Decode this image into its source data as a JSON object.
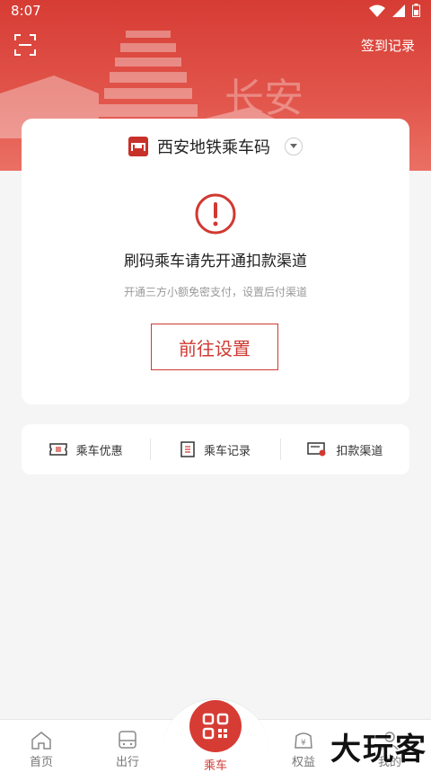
{
  "status_bar": {
    "time": "8:07"
  },
  "header": {
    "checkin_link": "签到记录"
  },
  "main_card": {
    "metro_title": "西安地铁乘车码",
    "alert_title": "刷码乘车请先开通扣款渠道",
    "alert_subtitle": "开通三方小额免密支付，设置后付渠道",
    "setup_button": "前往设置"
  },
  "quick_links": [
    {
      "label": "乘车优惠",
      "icon": "ticket-icon"
    },
    {
      "label": "乘车记录",
      "icon": "record-list-icon"
    },
    {
      "label": "扣款渠道",
      "icon": "payment-channel-icon"
    }
  ],
  "bottom_nav": {
    "items": [
      {
        "label": "首页",
        "icon": "home-icon"
      },
      {
        "label": "出行",
        "icon": "metro-train-icon"
      },
      {
        "label": "乘车",
        "icon": "qr-code-icon"
      },
      {
        "label": "权益",
        "icon": "wallet-icon"
      },
      {
        "label": "我的",
        "icon": "profile-icon"
      }
    ]
  },
  "watermark": "大玩客",
  "colors": {
    "brand_red": "#d03a32",
    "background": "#f5f5f5"
  }
}
